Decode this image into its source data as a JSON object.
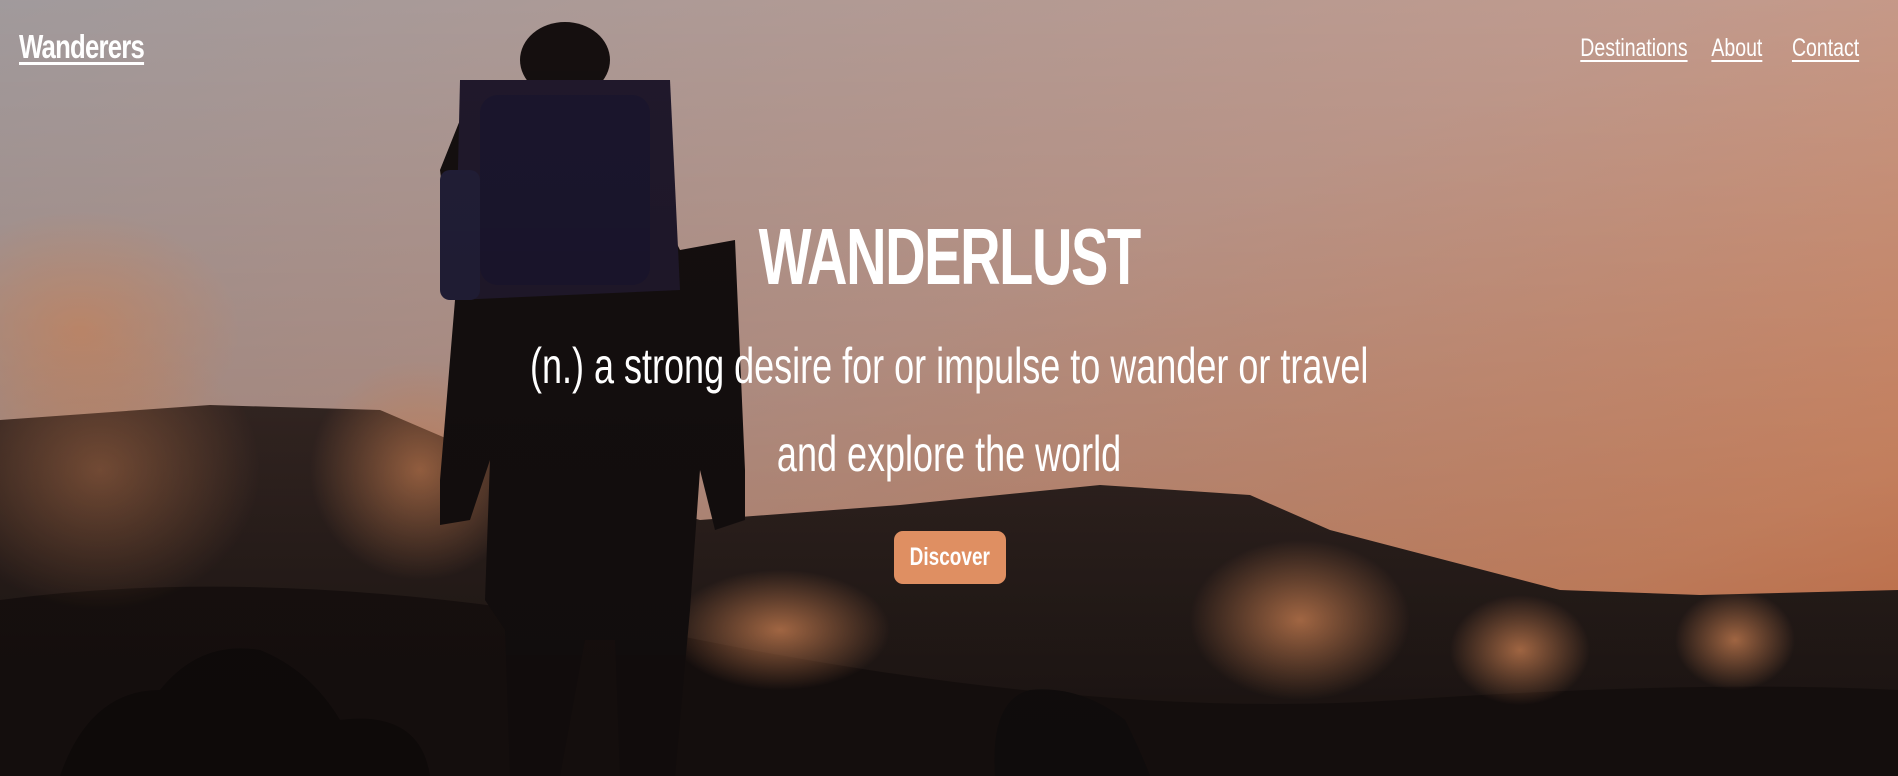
{
  "brand": {
    "name": "Wanderers"
  },
  "nav": {
    "links": [
      "Destinations",
      "About",
      "Contact"
    ]
  },
  "hero": {
    "title": "WANDERLUST",
    "subtitle_line1": "(n.) a strong desire for or impulse to wander or travel",
    "subtitle_line2": "and explore the world",
    "cta_label": "Discover"
  },
  "colors": {
    "button_bg": "#df8f62",
    "text": "#ffffff",
    "sky_top": "#a9a2a4",
    "sky_bottom": "#f08a55"
  },
  "icons": {
    "background": "hiker-mountain-sunset-photo"
  }
}
